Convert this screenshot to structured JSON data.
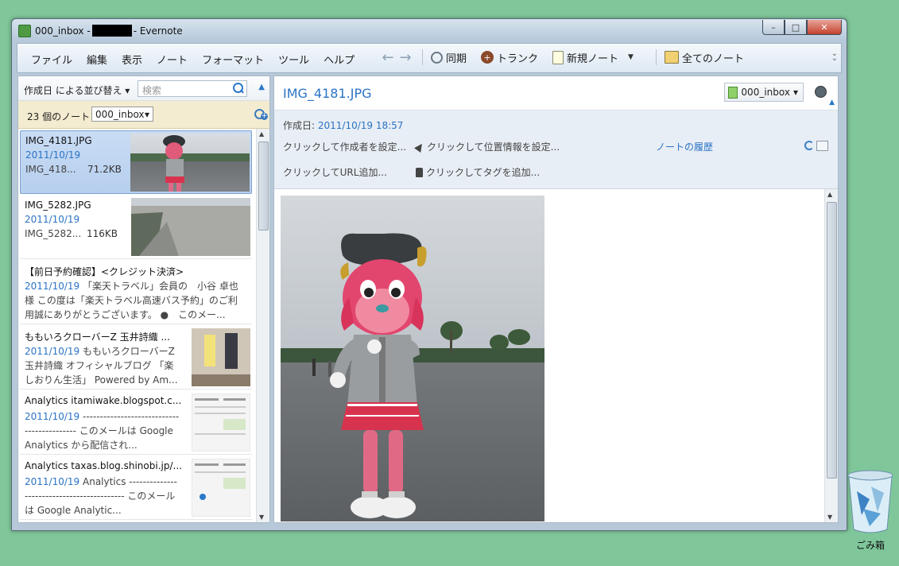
{
  "window": {
    "title_prefix": "000_inbox -",
    "title_suffix": "- Evernote",
    "controls": {
      "minimize": "–",
      "maximize": "□",
      "close": "✕"
    }
  },
  "menu": [
    "ファイル",
    "編集",
    "表示",
    "ノート",
    "フォーマット",
    "ツール",
    "ヘルプ"
  ],
  "toolbar": {
    "back": "←",
    "forward": "→",
    "sync": "同期",
    "trunk": "トランク",
    "new_note": "新規ノート",
    "all_notes": "全てのノート"
  },
  "list_header": {
    "sort": "作成日 による並び替え ▾",
    "search_placeholder": "検索",
    "count": "23 個のノート",
    "notebook": "000_inbox"
  },
  "notes": [
    {
      "title": "IMG_4181.JPG",
      "date": "2011/10/19",
      "snippet": "IMG_418...",
      "size": "71.2KB"
    },
    {
      "title": "IMG_5282.JPG",
      "date": "2011/10/19",
      "snippet": "IMG_5282...",
      "size": "116KB"
    },
    {
      "title": "【前日予約確認】<クレジット決済>",
      "date": "2011/10/19",
      "body": "「楽天トラベル」会員の　小谷 卓也　　様 この度は「楽天トラベル高速バス予約」のご利用誠にありがとうございます。 ●　このメー..."
    },
    {
      "title": "ももいろクローバーZ 玉井詩織 ...",
      "date": "2011/10/19",
      "body": "ももいろクローバーZ 玉井詩織 オフィシャルブログ 「楽しおりん生活」 Powered by Am..."
    },
    {
      "title": "Analytics itamiwake.blogspot.c...",
      "date": "2011/10/19",
      "body": "------------------------------------------- このメールは Google Analytics から配信され..."
    },
    {
      "title": "Analytics taxas.blog.shinobi.jp/...",
      "date": "2011/10/19",
      "body": "Analytics ------------------------------------------- このメールは Google Analytic..."
    }
  ],
  "note": {
    "title": "IMG_4181.JPG",
    "notebook": "000_inbox",
    "created_label": "作成日:",
    "created": "2011/10/19 18:57",
    "author": "クリックして作成者を設定...",
    "location": "クリックして位置情報を設定...",
    "history": "ノートの履歴",
    "url": "クリックしてURL追加...",
    "tags": "クリックしてタグを追加..."
  },
  "desktop": {
    "trash": "ごみ箱"
  }
}
